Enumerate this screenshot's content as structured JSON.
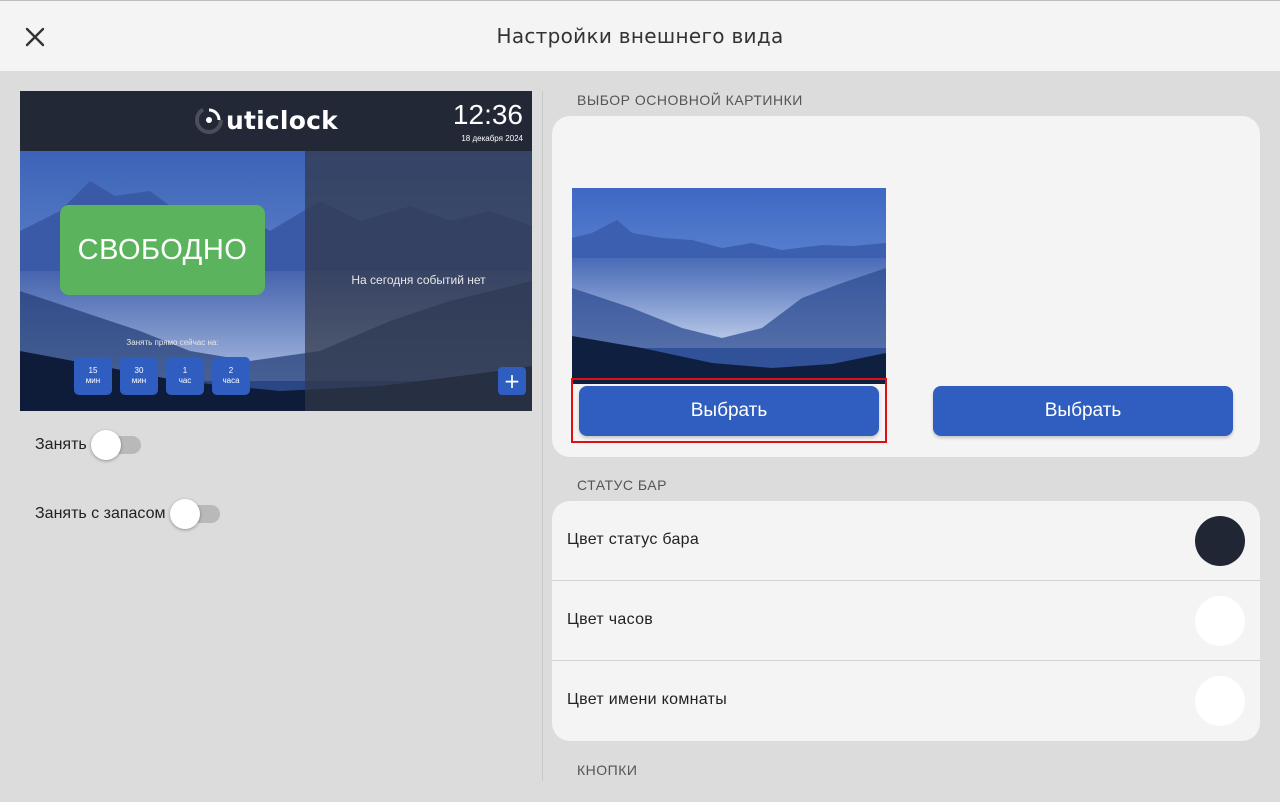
{
  "header": {
    "title": "Настройки внешнего вида"
  },
  "preview": {
    "logo_text": "uticlock",
    "clock": "12:36",
    "date": "18 декабря 2024",
    "status": "СВОБОДНО",
    "no_events": "На сегодня событий нет",
    "book_caption": "Занять прямо сейчас на:",
    "slots": [
      {
        "top": "15",
        "bottom": "мин"
      },
      {
        "top": "30",
        "bottom": "мин"
      },
      {
        "top": "1",
        "bottom": "час"
      },
      {
        "top": "2",
        "bottom": "часа"
      }
    ],
    "plus": "+"
  },
  "toggles": {
    "occupy": {
      "label": "Занять",
      "on": false
    },
    "occupy_reserve": {
      "label": "Занять с запасом",
      "on": false
    }
  },
  "background_section": {
    "title": "ВЫБОР ОСНОВНОЙ КАРТИНКИ",
    "select_label_1": "Выбрать",
    "select_label_2": "Выбрать"
  },
  "status_bar_section": {
    "title": "СТАТУС БАР",
    "rows": [
      {
        "label": "Цвет статус бара",
        "color": "#212635"
      },
      {
        "label": "Цвет часов",
        "color": "#ffffff"
      },
      {
        "label": "Цвет имени комнаты",
        "color": "#ffffff"
      }
    ]
  },
  "buttons_section": {
    "title": "КНОПКИ"
  },
  "colors": {
    "accent": "#2f5ec0",
    "free_green": "#5cb35d",
    "highlight": "#e01010"
  }
}
